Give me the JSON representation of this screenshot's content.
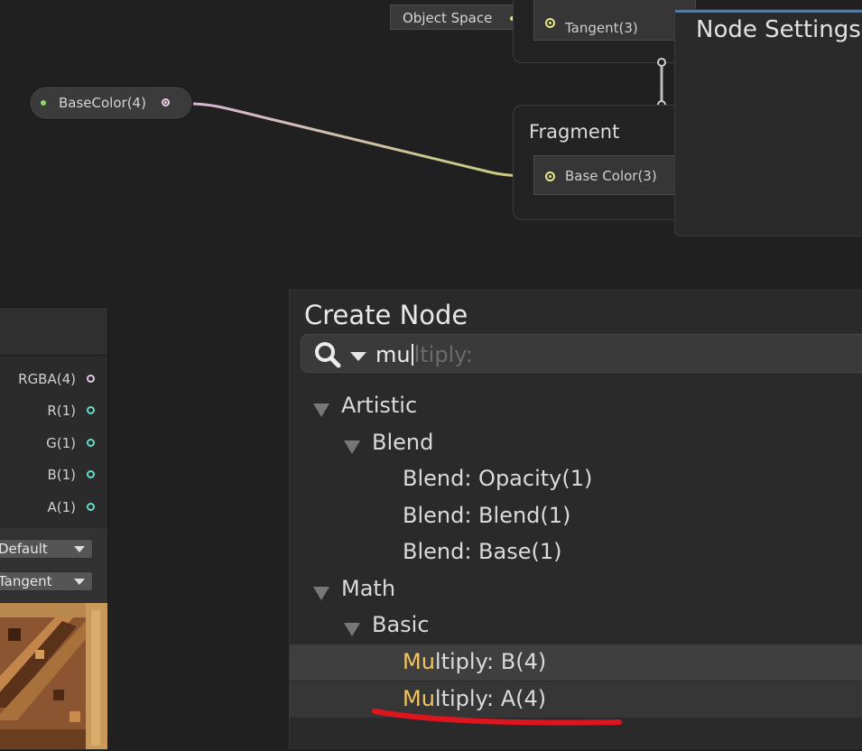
{
  "graph": {
    "property_node": {
      "label": "BaseColor(4)"
    },
    "object_space_chip": {
      "label": "Object Space"
    },
    "vertex_stack": {
      "slot_label": "Tangent(3)"
    },
    "fragment_stack": {
      "title": "Fragment",
      "slot_label": "Base Color(3)"
    },
    "node_settings": {
      "title": "Node Settings"
    }
  },
  "left_node": {
    "outputs": [
      "RGBA(4)",
      "R(1)",
      "G(1)",
      "B(1)",
      "A(1)"
    ],
    "dropdowns": [
      "Default",
      "Tangent"
    ]
  },
  "create_node": {
    "title": "Create Node",
    "search": {
      "typed": "mu",
      "suggestion_rest": "ltiply:"
    },
    "tree": [
      {
        "label": "Artistic",
        "level": 0,
        "expanded": true
      },
      {
        "label": "Blend",
        "level": 1,
        "expanded": true
      },
      {
        "label": "Blend: Opacity(1)",
        "level": 2
      },
      {
        "label": "Blend: Blend(1)",
        "level": 2
      },
      {
        "label": "Blend: Base(1)",
        "level": 2
      },
      {
        "label": "Math",
        "level": 0,
        "expanded": true
      },
      {
        "label": "Basic",
        "level": 1,
        "expanded": true
      },
      {
        "match": "Mu",
        "rest": "ltiply: B(4)",
        "level": 2,
        "highlight": "hover"
      },
      {
        "match": "Mu",
        "rest": "ltiply: A(4)",
        "level": 2,
        "highlight": "selected"
      }
    ]
  },
  "colors": {
    "background": "#202020",
    "accent_blue": "#3d7ec6",
    "match_highlight": "#f2c460",
    "annotation_red": "#e0141e"
  }
}
